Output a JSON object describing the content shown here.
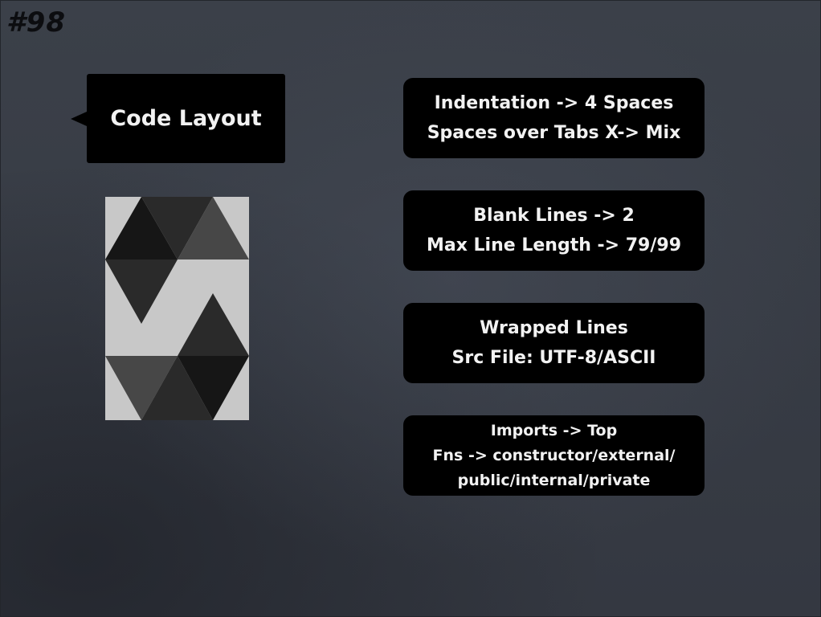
{
  "slide_number": "#98",
  "callout": {
    "title": "Code Layout"
  },
  "logo": {
    "icon": "solidity-logo-icon",
    "colors": {
      "background": "#c8c8c8",
      "dark": "#161616",
      "mid": "#2a2a2a",
      "light": "#474747"
    }
  },
  "boxes": [
    {
      "lines": [
        "Indentation -> 4 Spaces",
        "Spaces over Tabs X-> Mix"
      ]
    },
    {
      "lines": [
        "Blank Lines -> 2",
        "Max Line Length -> 79/99"
      ]
    },
    {
      "lines": [
        "Wrapped Lines",
        "Src File: UTF-8/ASCII"
      ]
    },
    {
      "lines": [
        "Imports -> Top",
        "Fns -> constructor/external/",
        "public/internal/private"
      ]
    }
  ]
}
